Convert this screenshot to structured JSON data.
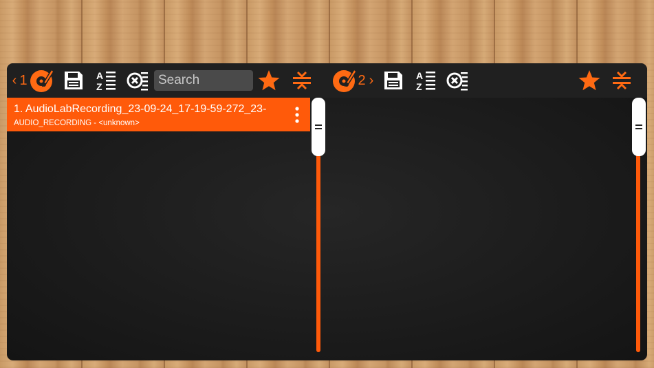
{
  "colors": {
    "accent": "#ff5a0a",
    "panel": "#1b1b1b",
    "toolbar": "#202020"
  },
  "deck1": {
    "prev_chevron": "‹",
    "number": "1",
    "search_placeholder": "Search",
    "icons": [
      "turntable-icon",
      "save-icon",
      "sort-az-icon",
      "clear-list-icon",
      "star-icon",
      "collapse-icon"
    ]
  },
  "deck2": {
    "number": "2",
    "next_chevron": "›",
    "icons": [
      "turntable-icon",
      "save-icon",
      "sort-az-icon",
      "clear-list-icon",
      "star-icon",
      "collapse-icon"
    ]
  },
  "playlist1": {
    "tracks": [
      {
        "title": "1. AudioLabRecording_23-09-24_17-19-59-272_23-",
        "subtitle": "AUDIO_RECORDING - <unknown>"
      }
    ]
  }
}
